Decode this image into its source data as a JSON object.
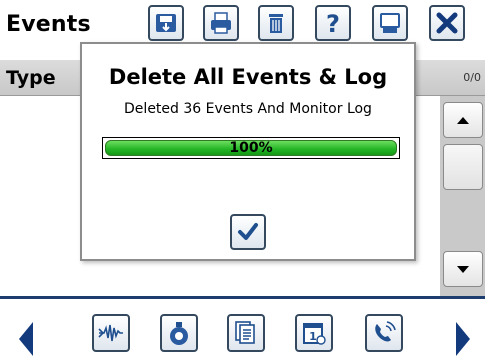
{
  "window": {
    "title": "Events"
  },
  "toolbar": {
    "buttons": [
      {
        "icon": "save-icon"
      },
      {
        "icon": "print-icon"
      },
      {
        "icon": "trash-icon"
      },
      {
        "icon": "help-icon"
      },
      {
        "icon": "monitor-icon"
      },
      {
        "icon": "close-icon"
      }
    ]
  },
  "table": {
    "column_type": "Type",
    "count": "0/0"
  },
  "dialog": {
    "title": "Delete All Events & Log",
    "message": "Deleted 36 Events And Monitor Log",
    "progress_label": "100%",
    "progress_fraction": 1.0,
    "ok_icon": "checkmark-icon"
  },
  "bottom_nav": {
    "buttons": [
      {
        "icon": "waveform-icon"
      },
      {
        "icon": "sensor-icon"
      },
      {
        "icon": "documents-icon"
      },
      {
        "icon": "calendar-icon"
      },
      {
        "icon": "phone-icon"
      }
    ]
  },
  "colors": {
    "accent_navy": "#133a7c",
    "icon_blue": "#1f4f8f",
    "progress_green": "#22b424",
    "header_gray": "#cfcfcf"
  }
}
